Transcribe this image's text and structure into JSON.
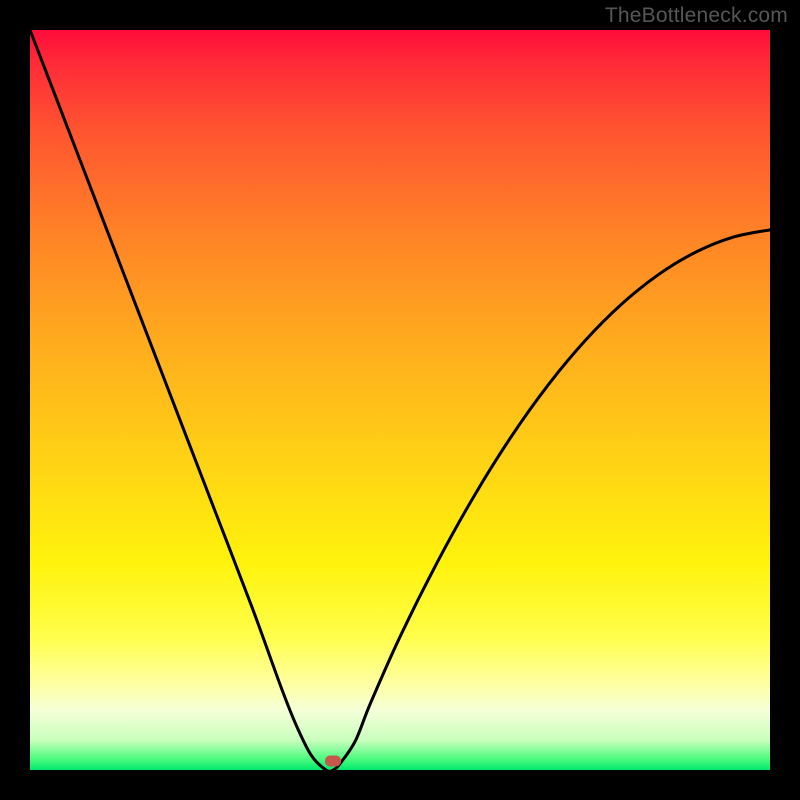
{
  "watermark": {
    "text": "TheBottleneck.com"
  },
  "chart_data": {
    "type": "line",
    "title": "",
    "xlabel": "",
    "ylabel": "",
    "xlim": [
      0,
      100
    ],
    "ylim": [
      0,
      100
    ],
    "grid": false,
    "legend": false,
    "series": [
      {
        "name": "bottleneck-curve",
        "x": [
          0,
          5,
          10,
          15,
          20,
          25,
          30,
          34,
          36,
          38,
          40,
          41,
          42,
          44,
          46,
          50,
          55,
          60,
          65,
          70,
          75,
          80,
          85,
          90,
          95,
          100
        ],
        "y": [
          100,
          87,
          74,
          61,
          48,
          35,
          22,
          11,
          6,
          2,
          0,
          0,
          1,
          4,
          9,
          18,
          28,
          37,
          45,
          52,
          58,
          63,
          67,
          70,
          72,
          73
        ]
      }
    ],
    "marker": {
      "x": 41,
      "y": 1.2,
      "label": "optimal-point"
    },
    "background_gradient": {
      "top": "#ff0c3a",
      "mid": "#fff30c",
      "bottom": "#00e86b"
    }
  }
}
